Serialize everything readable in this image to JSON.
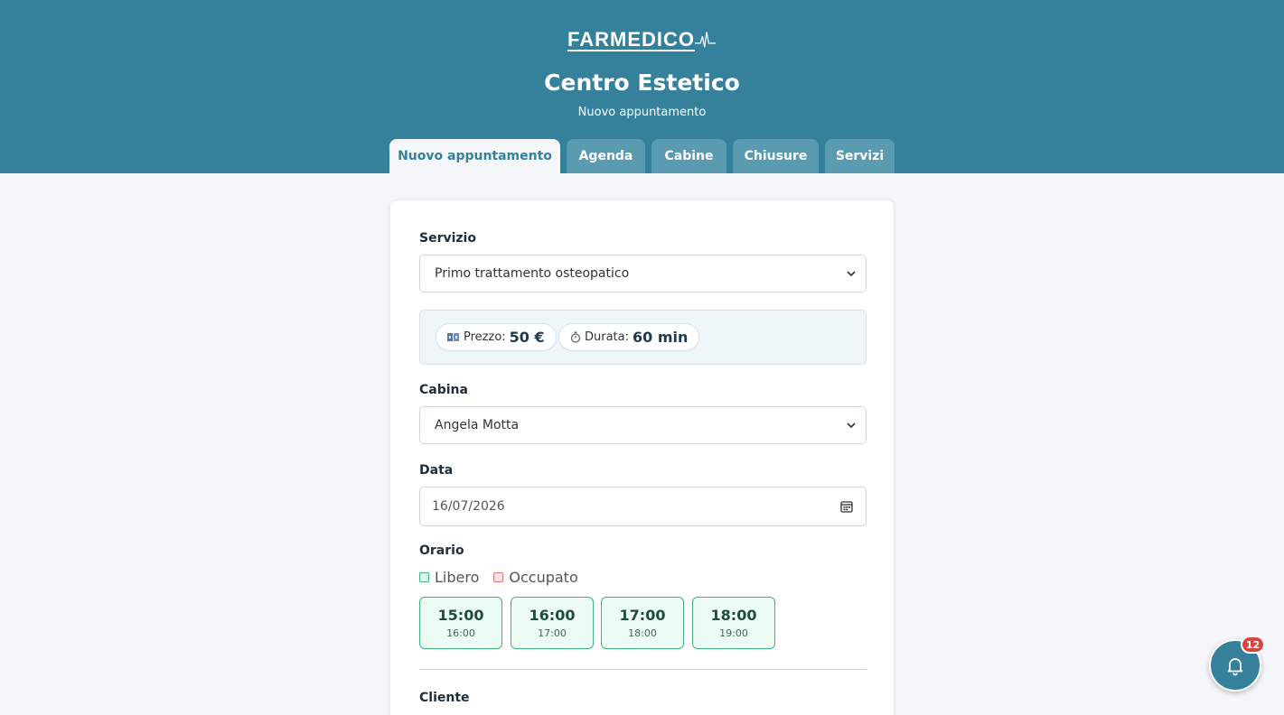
{
  "brand": {
    "logo_text": "FARMEDICO"
  },
  "header": {
    "title": "Centro Estetico",
    "subtitle": "Nuovo appuntamento"
  },
  "tabs": [
    {
      "label": "Nuovo appuntamento",
      "active": true
    },
    {
      "label": "Agenda",
      "active": false
    },
    {
      "label": "Cabine",
      "active": false
    },
    {
      "label": "Chiusure",
      "active": false
    },
    {
      "label": "Servizi",
      "active": false
    }
  ],
  "form": {
    "servizio": {
      "label": "Servizio",
      "value": "Primo trattamento osteopatico"
    },
    "info": {
      "price_label": "Prezzo:",
      "price_value": "50 €",
      "duration_label": "Durata:",
      "duration_value": "60 min"
    },
    "cabina": {
      "label": "Cabina",
      "value": "Angela Motta"
    },
    "data": {
      "label": "Data",
      "value": "16/07/2026"
    },
    "orario": {
      "label": "Orario",
      "legend_free": "Libero",
      "legend_busy": "Occupato",
      "slots": [
        {
          "start": "15:00",
          "end": "16:00"
        },
        {
          "start": "16:00",
          "end": "17:00"
        },
        {
          "start": "17:00",
          "end": "18:00"
        },
        {
          "start": "18:00",
          "end": "19:00"
        }
      ]
    },
    "cliente": {
      "label": "Cliente"
    }
  },
  "notifications": {
    "count": "12",
    "icon": "bell-icon"
  },
  "colors": {
    "primary": "#35819c",
    "free": "#3fb37a",
    "busy": "#e07a72",
    "badge": "#d9463f"
  }
}
